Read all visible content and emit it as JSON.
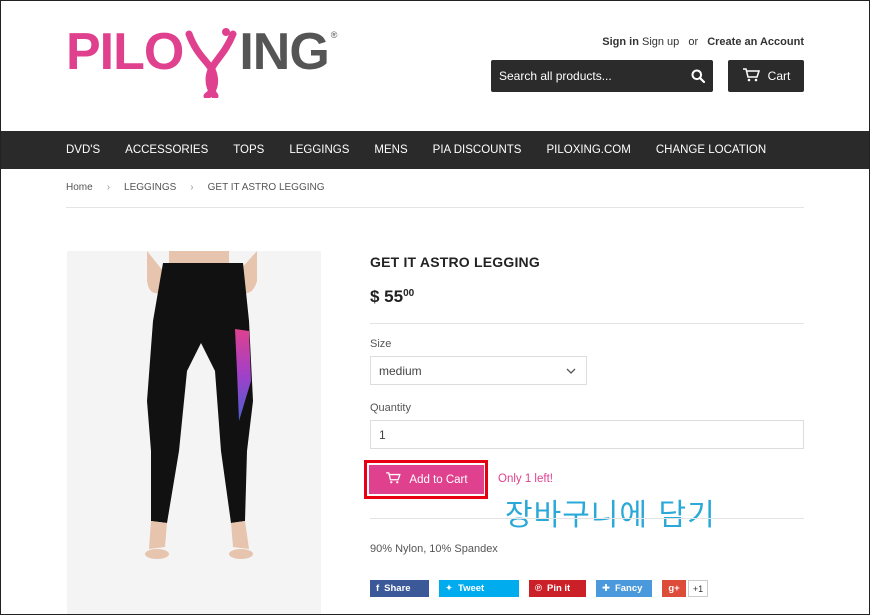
{
  "brand": {
    "logo_left": "PILO",
    "logo_right": "ING",
    "logo_registered": "®",
    "pink": "#e0418e",
    "dark": "#2a2a2a"
  },
  "header": {
    "sign_in": "Sign in",
    "sign_up": "Sign up",
    "or": "or",
    "create_account": "Create an Account",
    "search_placeholder": "Search all products...",
    "search_icon": "search-icon",
    "cart_label": "Cart",
    "cart_icon": "cart-icon"
  },
  "nav": {
    "items": [
      "DVD'S",
      "ACCESSORIES",
      "TOPS",
      "LEGGINGS",
      "MENS",
      "PIA DISCOUNTS",
      "PILOXING.COM",
      "CHANGE LOCATION"
    ]
  },
  "breadcrumb": {
    "items": [
      "Home",
      "LEGGINGS",
      "GET IT ASTRO LEGGING"
    ],
    "separator": "›"
  },
  "product": {
    "title": "GET IT ASTRO LEGGING",
    "price_main": "$ 55",
    "price_cents": "00",
    "size_label": "Size",
    "size_value": "medium",
    "quantity_label": "Quantity",
    "quantity_value": "1",
    "add_to_cart": "Add to Cart",
    "stock_note": "Only 1 left!",
    "description": "90% Nylon, 10% Spandex"
  },
  "annotation": {
    "text": "장바구니에 담기",
    "color": "#2aa8d8",
    "highlight_color": "#e60012"
  },
  "share": {
    "facebook": "Share",
    "twitter": "Tweet",
    "pinterest": "Pin it",
    "fancy": "Fancy",
    "gplus": "g+",
    "gplus_count": "+1"
  }
}
